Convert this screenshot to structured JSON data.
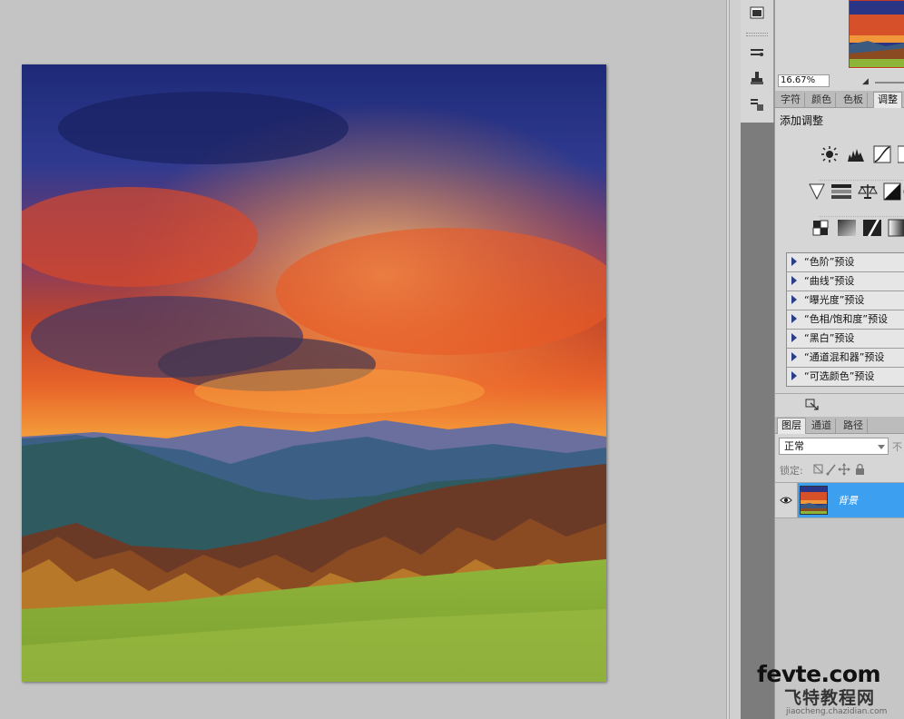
{
  "navigator": {
    "zoom": "16.67%"
  },
  "adjust_panel": {
    "tabs": [
      "字符",
      "颜色",
      "色板",
      "调整"
    ],
    "active_tab": "调整",
    "add_label": "添加调整",
    "presets": [
      "“色阶”预设",
      "“曲线”预设",
      "“曝光度”预设",
      "“色相/饱和度”预设",
      "“黑白”预设",
      "“通道混和器”预设",
      "“可选颜色”预设"
    ]
  },
  "layers_panel": {
    "tabs": [
      "图层",
      "通道",
      "路径"
    ],
    "active_tab": "图层",
    "blend_mode": "正常",
    "opacity_label_trunc": "不",
    "lock_label": "锁定:",
    "layer_name": "背景"
  },
  "watermark": {
    "line1": "fevte.com",
    "line2": "飞特教程网",
    "line3": "jiaocheng.chazidian.com"
  },
  "colors": {
    "selection_blue": "#3c9fef",
    "panel_gray": "#d6d6d6",
    "canvas_gray": "#c4c4c4",
    "preset_triangle": "#2a3f88"
  }
}
